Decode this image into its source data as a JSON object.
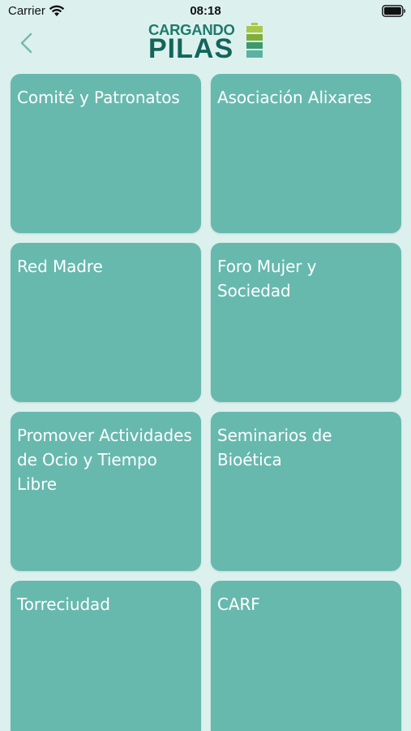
{
  "status_bar": {
    "carrier": "Carrier",
    "time": "08:18"
  },
  "nav": {
    "back_icon": "chevron-left-icon",
    "logo_top": "CARGANDO",
    "logo_bottom": "PILAS"
  },
  "tiles": [
    {
      "label": "Comité y Patronatos"
    },
    {
      "label": "Asociación Alixares"
    },
    {
      "label": "Red Madre"
    },
    {
      "label": "Foro Mujer y Sociedad"
    },
    {
      "label": "Promover Actividades de Ocio y Tiempo Libre"
    },
    {
      "label": "Seminarios de Bioética"
    },
    {
      "label": "Torreciudad"
    },
    {
      "label": "CARF"
    }
  ],
  "colors": {
    "background": "#dcf1ee",
    "tile": "#67b9ae",
    "logo_dark": "#13655a",
    "logo_light": "#1f7a6c",
    "battery_green_light": "#a9c84a",
    "battery_green_mid": "#7fae3c",
    "back_chevron": "#7bb9ae"
  }
}
